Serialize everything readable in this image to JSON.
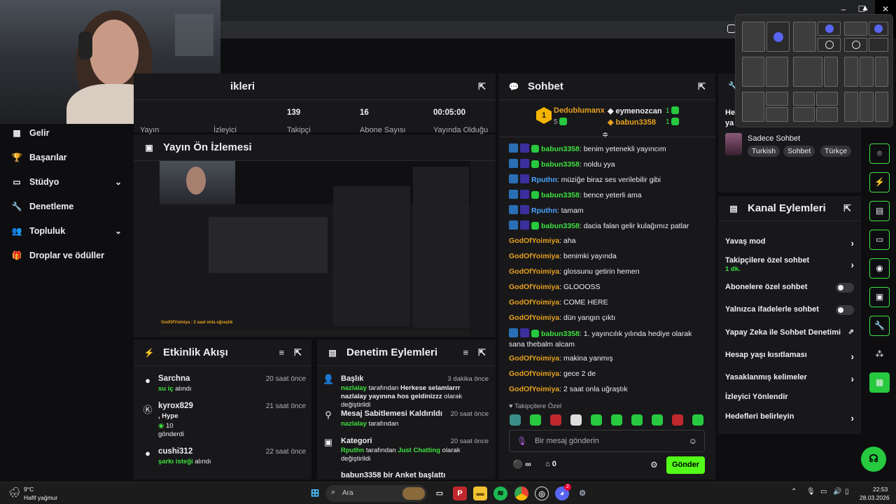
{
  "window": {
    "minimize": "–",
    "maximize": "☐",
    "close": "✕"
  },
  "sidebar": {
    "items": [
      {
        "label": "Gelir",
        "icon": "revenue-icon",
        "glyph": "▦"
      },
      {
        "label": "Başarılar",
        "icon": "trophy-icon",
        "glyph": "🏆"
      },
      {
        "label": "Stüdyo",
        "icon": "studio-icon",
        "glyph": "▭"
      },
      {
        "label": "Denetleme",
        "icon": "wrench-icon",
        "glyph": "🔧"
      },
      {
        "label": "Topluluk",
        "icon": "community-icon",
        "glyph": "👥"
      },
      {
        "label": "Droplar ve ödüller",
        "icon": "drops-icon",
        "glyph": "🎁"
      }
    ]
  },
  "stats_panel": {
    "title_fragment": "ikleri",
    "values": [
      "139",
      "16",
      "00:05:00"
    ],
    "labels": [
      "Yayın",
      "İzleyici",
      "Takipçi",
      "Abone Sayısı",
      "Yayında Olduğu"
    ]
  },
  "preview": {
    "title": "Yayın Ön İzlemesi",
    "caption": "GodOfYoimiya : 2 saat onla uğraştık"
  },
  "activity": {
    "title": "Etkinlik Akışı",
    "items": [
      {
        "name": "Sarchna",
        "time": "20 saat önce",
        "highlight": "su iç",
        "rest": " alındı"
      },
      {
        "name": "kyrox829",
        "time": "21 saat önce",
        "line1": ", Hype",
        "count": "10",
        "line3": "gönderdi"
      },
      {
        "name": "cushi312",
        "time": "22 saat önce",
        "highlight": "şarkı isteği",
        "rest": " alındı"
      }
    ]
  },
  "mod_actions": {
    "title": "Denetim Eylemleri",
    "items": [
      {
        "title": "Başlık",
        "time": "3 dakika önce",
        "user": "nazlalay",
        "mid": " tarafından ",
        "value": "Herkese selamlarrr nazlalay yayınına hos geldinizzz",
        "end": " olarak değiştirildi"
      },
      {
        "title": "Mesaj Sabitlemesi Kaldırıldı",
        "time": "20 saat önce",
        "user": "nazlalay",
        "end": " tarafından"
      },
      {
        "title": "Kategori",
        "time": "20 saat önce",
        "user": "Rputhn",
        "mid": " tarafından ",
        "value": "Just Chatting",
        "end": " olarak değiştirildi"
      },
      {
        "title": "babun3358 bir Anket başlattı"
      }
    ]
  },
  "chat": {
    "title": "Sohbet",
    "leaderboard": {
      "rank": "1",
      "first_name": "Dedublumanx",
      "first_count": "5",
      "second_name": "eymenozcan",
      "second_count": "1",
      "third_name": "babun3358",
      "third_count": "1"
    },
    "messages": [
      {
        "user": "babun3358",
        "text": ": benim yetenekli yayıncım",
        "color": "green",
        "badges": true
      },
      {
        "user": "babun3358",
        "text": ": noldu yya",
        "color": "green",
        "badges": true
      },
      {
        "user": "Rputhn",
        "text": ": müziğe biraz ses verilebilir gibi",
        "color": "blue",
        "badges": true
      },
      {
        "user": "babun3358",
        "text": ": bence yeterli ama",
        "color": "green",
        "badges": true
      },
      {
        "user": "Rputhn",
        "text": ": tamam",
        "color": "blue",
        "badges": true
      },
      {
        "user": "babun3358",
        "text": ": dacia falan gelir kulağımız patlar",
        "color": "green",
        "badges": true
      },
      {
        "user": "GodOfYoimiya",
        "text": ": aha",
        "color": "orange",
        "badges": false
      },
      {
        "user": "GodOfYoimiya",
        "text": ": benimki yayında",
        "color": "orange",
        "badges": false
      },
      {
        "user": "GodOfYoimiya",
        "text": ": glossunu getirin hemen",
        "color": "orange",
        "badges": false
      },
      {
        "user": "GodOfYoimiya",
        "text": ": GLOOOSS",
        "color": "orange",
        "badges": false
      },
      {
        "user": "GodOfYoimiya",
        "text": ": COME HERE",
        "color": "orange",
        "badges": false
      },
      {
        "user": "GodOfYoimiya",
        "text": ": dün yangın çıktı",
        "color": "orange",
        "badges": false
      },
      {
        "user": "babun3358",
        "text": ": 1. yayıncılık yılında hediye olarak sana thebalm alcam",
        "color": "green",
        "badges": true
      },
      {
        "user": "GodOfYoimiya",
        "text": ": makina yanmış",
        "color": "orange",
        "badges": false
      },
      {
        "user": "GodOfYoimiya",
        "text": ": gece 2 de",
        "color": "orange",
        "badges": false
      },
      {
        "user": "GodOfYoimiya",
        "text": ": 2 saat onla uğraştık",
        "color": "orange",
        "badges": false
      }
    ],
    "followers_only": "Takipçilere Özel",
    "input_placeholder": "Bir mesaj gönderin",
    "points": "∞",
    "vip_count": "0",
    "send_label": "Gönder"
  },
  "mod_panel": {
    "header_fragment_1": "He",
    "header_fragment_2": "ya",
    "mode_name": "Sadece Sohbet",
    "tags": [
      "Turkish",
      "Sohbet",
      "Türkçe"
    ]
  },
  "channel_actions": {
    "title": "Kanal Eylemleri",
    "items": [
      {
        "label": "Yavaş mod",
        "kind": "chevron"
      },
      {
        "label": "Takipçilere özel sohbet",
        "sub": "1 dk.",
        "kind": "chevron"
      },
      {
        "label": "Abonelere özel sohbet",
        "kind": "toggle"
      },
      {
        "label": "Yalnızca ifadelerle sohbet",
        "kind": "toggle"
      },
      {
        "label": "Yapay Zeka ile Sohbet Denetimi",
        "kind": "external"
      },
      {
        "label": "Hesap yaşı kısıtlaması",
        "kind": "chevron"
      },
      {
        "label": "Yasaklanmış kelimeler",
        "kind": "chevron"
      },
      {
        "label": "İzleyici Yönlendir",
        "kind": "none"
      },
      {
        "label": "Hedefleri belirleyin",
        "kind": "chevron"
      }
    ]
  },
  "taskbar": {
    "weather_temp": "9°C",
    "weather_desc": "Hafif yağmur",
    "search_placeholder": "Ara",
    "time": "22:53",
    "date": "28.03.2026",
    "badge_count": "2"
  },
  "colors": {
    "accent": "#3ee13e",
    "panel": "#18181b",
    "background": "#0e0e10"
  }
}
